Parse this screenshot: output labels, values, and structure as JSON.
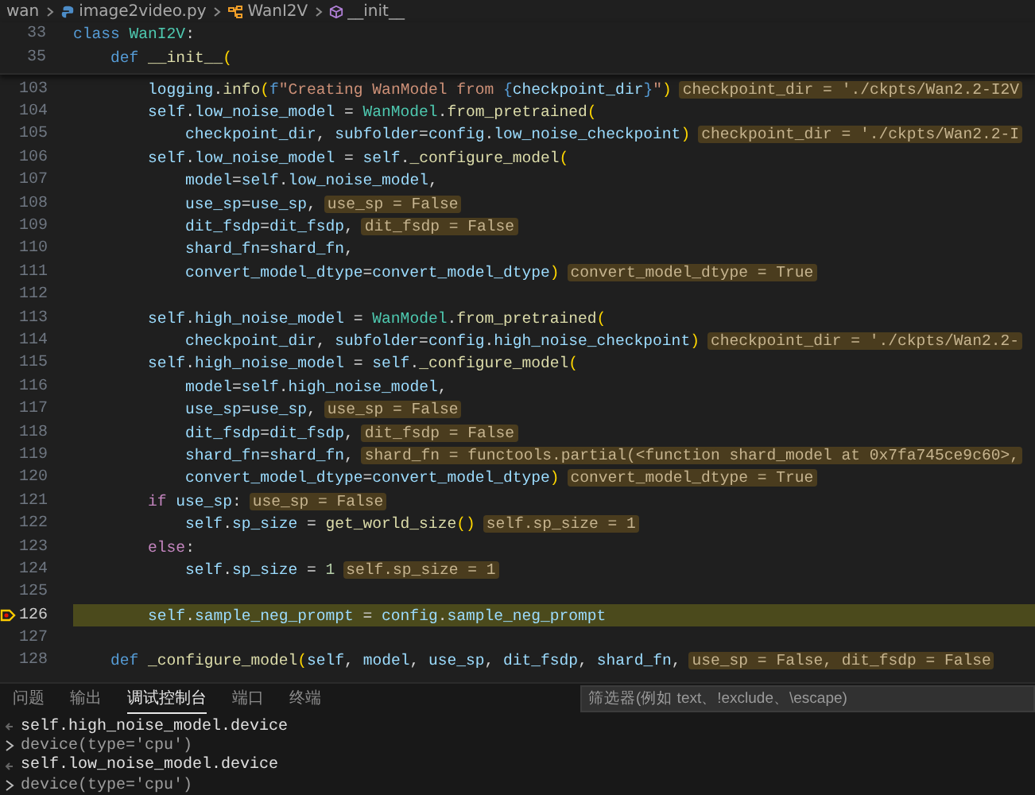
{
  "breadcrumb": [
    {
      "kind": "folder",
      "label": "wan"
    },
    {
      "kind": "file",
      "label": "image2video.py"
    },
    {
      "kind": "class",
      "label": "WanI2V"
    },
    {
      "kind": "method",
      "label": "__init__"
    }
  ],
  "sticky_lines": [
    {
      "number": "33",
      "tokens": [
        {
          "kind": "keyword",
          "text": "class "
        },
        {
          "kind": "type",
          "text": "WanI2V"
        },
        {
          "kind": "plain",
          "text": ":"
        }
      ]
    },
    {
      "number": "35",
      "tokens": [
        {
          "kind": "keyword",
          "text": "    def "
        },
        {
          "kind": "function",
          "text": "__init__"
        },
        {
          "kind": "bracket",
          "text": "("
        }
      ]
    }
  ],
  "lines": [
    {
      "number": "103",
      "current": false,
      "tokens": [
        {
          "kind": "variable",
          "text": "        logging"
        },
        {
          "kind": "plain",
          "text": "."
        },
        {
          "kind": "function",
          "text": "info"
        },
        {
          "kind": "bracket",
          "text": "("
        },
        {
          "kind": "keyword",
          "text": "f"
        },
        {
          "kind": "string",
          "text": "\"Creating WanModel from "
        },
        {
          "kind": "keyword",
          "text": "{"
        },
        {
          "kind": "variable",
          "text": "checkpoint_dir"
        },
        {
          "kind": "keyword",
          "text": "}"
        },
        {
          "kind": "string",
          "text": "\""
        },
        {
          "kind": "bracket",
          "text": ")"
        }
      ],
      "hint": "checkpoint_dir = './ckpts/Wan2.2-I2V"
    },
    {
      "number": "104",
      "current": false,
      "tokens": [
        {
          "kind": "variable",
          "text": "        self"
        },
        {
          "kind": "plain",
          "text": "."
        },
        {
          "kind": "variable",
          "text": "low_noise_model"
        },
        {
          "kind": "plain",
          "text": " = "
        },
        {
          "kind": "type",
          "text": "WanModel"
        },
        {
          "kind": "plain",
          "text": "."
        },
        {
          "kind": "function",
          "text": "from_pretrained"
        },
        {
          "kind": "bracket",
          "text": "("
        }
      ]
    },
    {
      "number": "105",
      "current": false,
      "tokens": [
        {
          "kind": "variable",
          "text": "            checkpoint_dir"
        },
        {
          "kind": "plain",
          "text": ", "
        },
        {
          "kind": "variable",
          "text": "subfolder"
        },
        {
          "kind": "plain",
          "text": "="
        },
        {
          "kind": "variable",
          "text": "config"
        },
        {
          "kind": "plain",
          "text": "."
        },
        {
          "kind": "variable",
          "text": "low_noise_checkpoint"
        },
        {
          "kind": "bracket",
          "text": ")"
        }
      ],
      "hint": "checkpoint_dir = './ckpts/Wan2.2-I"
    },
    {
      "number": "106",
      "current": false,
      "tokens": [
        {
          "kind": "variable",
          "text": "        self"
        },
        {
          "kind": "plain",
          "text": "."
        },
        {
          "kind": "variable",
          "text": "low_noise_model"
        },
        {
          "kind": "plain",
          "text": " = "
        },
        {
          "kind": "variable",
          "text": "self"
        },
        {
          "kind": "plain",
          "text": "."
        },
        {
          "kind": "function",
          "text": "_configure_model"
        },
        {
          "kind": "bracket",
          "text": "("
        }
      ]
    },
    {
      "number": "107",
      "current": false,
      "tokens": [
        {
          "kind": "variable",
          "text": "            model"
        },
        {
          "kind": "plain",
          "text": "="
        },
        {
          "kind": "variable",
          "text": "self"
        },
        {
          "kind": "plain",
          "text": "."
        },
        {
          "kind": "variable",
          "text": "low_noise_model"
        },
        {
          "kind": "plain",
          "text": ","
        }
      ]
    },
    {
      "number": "108",
      "current": false,
      "tokens": [
        {
          "kind": "variable",
          "text": "            use_sp"
        },
        {
          "kind": "plain",
          "text": "="
        },
        {
          "kind": "variable",
          "text": "use_sp"
        },
        {
          "kind": "plain",
          "text": ","
        }
      ],
      "hint": "use_sp = False"
    },
    {
      "number": "109",
      "current": false,
      "tokens": [
        {
          "kind": "variable",
          "text": "            dit_fsdp"
        },
        {
          "kind": "plain",
          "text": "="
        },
        {
          "kind": "variable",
          "text": "dit_fsdp"
        },
        {
          "kind": "plain",
          "text": ","
        }
      ],
      "hint": "dit_fsdp = False"
    },
    {
      "number": "110",
      "current": false,
      "tokens": [
        {
          "kind": "variable",
          "text": "            shard_fn"
        },
        {
          "kind": "plain",
          "text": "="
        },
        {
          "kind": "variable",
          "text": "shard_fn"
        },
        {
          "kind": "plain",
          "text": ","
        }
      ]
    },
    {
      "number": "111",
      "current": false,
      "tokens": [
        {
          "kind": "variable",
          "text": "            convert_model_dtype"
        },
        {
          "kind": "plain",
          "text": "="
        },
        {
          "kind": "variable",
          "text": "convert_model_dtype"
        },
        {
          "kind": "bracket",
          "text": ")"
        }
      ],
      "hint": "convert_model_dtype = True"
    },
    {
      "number": "112",
      "current": false
    },
    {
      "number": "113",
      "current": false,
      "tokens": [
        {
          "kind": "variable",
          "text": "        self"
        },
        {
          "kind": "plain",
          "text": "."
        },
        {
          "kind": "variable",
          "text": "high_noise_model"
        },
        {
          "kind": "plain",
          "text": " = "
        },
        {
          "kind": "type",
          "text": "WanModel"
        },
        {
          "kind": "plain",
          "text": "."
        },
        {
          "kind": "function",
          "text": "from_pretrained"
        },
        {
          "kind": "bracket",
          "text": "("
        }
      ]
    },
    {
      "number": "114",
      "current": false,
      "tokens": [
        {
          "kind": "variable",
          "text": "            checkpoint_dir"
        },
        {
          "kind": "plain",
          "text": ", "
        },
        {
          "kind": "variable",
          "text": "subfolder"
        },
        {
          "kind": "plain",
          "text": "="
        },
        {
          "kind": "variable",
          "text": "config"
        },
        {
          "kind": "plain",
          "text": "."
        },
        {
          "kind": "variable",
          "text": "high_noise_checkpoint"
        },
        {
          "kind": "bracket",
          "text": ")"
        }
      ],
      "hint": "checkpoint_dir = './ckpts/Wan2.2-"
    },
    {
      "number": "115",
      "current": false,
      "tokens": [
        {
          "kind": "variable",
          "text": "        self"
        },
        {
          "kind": "plain",
          "text": "."
        },
        {
          "kind": "variable",
          "text": "high_noise_model"
        },
        {
          "kind": "plain",
          "text": " = "
        },
        {
          "kind": "variable",
          "text": "self"
        },
        {
          "kind": "plain",
          "text": "."
        },
        {
          "kind": "function",
          "text": "_configure_model"
        },
        {
          "kind": "bracket",
          "text": "("
        }
      ]
    },
    {
      "number": "116",
      "current": false,
      "tokens": [
        {
          "kind": "variable",
          "text": "            model"
        },
        {
          "kind": "plain",
          "text": "="
        },
        {
          "kind": "variable",
          "text": "self"
        },
        {
          "kind": "plain",
          "text": "."
        },
        {
          "kind": "variable",
          "text": "high_noise_model"
        },
        {
          "kind": "plain",
          "text": ","
        }
      ]
    },
    {
      "number": "117",
      "current": false,
      "tokens": [
        {
          "kind": "variable",
          "text": "            use_sp"
        },
        {
          "kind": "plain",
          "text": "="
        },
        {
          "kind": "variable",
          "text": "use_sp"
        },
        {
          "kind": "plain",
          "text": ","
        }
      ],
      "hint": "use_sp = False"
    },
    {
      "number": "118",
      "current": false,
      "tokens": [
        {
          "kind": "variable",
          "text": "            dit_fsdp"
        },
        {
          "kind": "plain",
          "text": "="
        },
        {
          "kind": "variable",
          "text": "dit_fsdp"
        },
        {
          "kind": "plain",
          "text": ","
        }
      ],
      "hint": "dit_fsdp = False"
    },
    {
      "number": "119",
      "current": false,
      "tokens": [
        {
          "kind": "variable",
          "text": "            shard_fn"
        },
        {
          "kind": "plain",
          "text": "="
        },
        {
          "kind": "variable",
          "text": "shard_fn"
        },
        {
          "kind": "plain",
          "text": ","
        }
      ],
      "hint": "shard_fn = functools.partial(<function shard_model at 0x7fa745ce9c60>,"
    },
    {
      "number": "120",
      "current": false,
      "tokens": [
        {
          "kind": "variable",
          "text": "            convert_model_dtype"
        },
        {
          "kind": "plain",
          "text": "="
        },
        {
          "kind": "variable",
          "text": "convert_model_dtype"
        },
        {
          "kind": "bracket",
          "text": ")"
        }
      ],
      "hint": "convert_model_dtype = True"
    },
    {
      "number": "121",
      "current": false,
      "tokens": [
        {
          "kind": "control",
          "text": "        if "
        },
        {
          "kind": "variable",
          "text": "use_sp"
        },
        {
          "kind": "plain",
          "text": ":"
        }
      ],
      "hint": "use_sp = False"
    },
    {
      "number": "122",
      "current": false,
      "tokens": [
        {
          "kind": "variable",
          "text": "            self"
        },
        {
          "kind": "plain",
          "text": "."
        },
        {
          "kind": "variable",
          "text": "sp_size"
        },
        {
          "kind": "plain",
          "text": " = "
        },
        {
          "kind": "function",
          "text": "get_world_size"
        },
        {
          "kind": "bracket",
          "text": "()"
        }
      ],
      "hint": "self.sp_size = 1"
    },
    {
      "number": "123",
      "current": false,
      "tokens": [
        {
          "kind": "control",
          "text": "        else"
        },
        {
          "kind": "plain",
          "text": ":"
        }
      ]
    },
    {
      "number": "124",
      "current": false,
      "tokens": [
        {
          "kind": "variable",
          "text": "            self"
        },
        {
          "kind": "plain",
          "text": "."
        },
        {
          "kind": "variable",
          "text": "sp_size"
        },
        {
          "kind": "plain",
          "text": " = "
        },
        {
          "kind": "number",
          "text": "1"
        }
      ],
      "hint": "self.sp_size = 1"
    },
    {
      "number": "125",
      "current": false
    },
    {
      "number": "126",
      "current": true,
      "tokens": [
        {
          "kind": "variable",
          "text": "        self"
        },
        {
          "kind": "plain",
          "text": "."
        },
        {
          "kind": "variable",
          "text": "sample_neg_prompt"
        },
        {
          "kind": "plain",
          "text": " = "
        },
        {
          "kind": "variable",
          "text": "config"
        },
        {
          "kind": "plain",
          "text": "."
        },
        {
          "kind": "variable",
          "text": "sample_neg_prompt"
        }
      ]
    },
    {
      "number": "127",
      "current": false
    },
    {
      "number": "128",
      "current": false,
      "tokens": [
        {
          "kind": "keyword",
          "text": "    def "
        },
        {
          "kind": "function",
          "text": "_configure_model"
        },
        {
          "kind": "bracket",
          "text": "("
        },
        {
          "kind": "variable",
          "text": "self"
        },
        {
          "kind": "plain",
          "text": ", "
        },
        {
          "kind": "variable",
          "text": "model"
        },
        {
          "kind": "plain",
          "text": ", "
        },
        {
          "kind": "variable",
          "text": "use_sp"
        },
        {
          "kind": "plain",
          "text": ", "
        },
        {
          "kind": "variable",
          "text": "dit_fsdp"
        },
        {
          "kind": "plain",
          "text": ", "
        },
        {
          "kind": "variable",
          "text": "shard_fn"
        },
        {
          "kind": "plain",
          "text": ","
        }
      ],
      "hint": "use_sp = False, dit_fsdp = False"
    }
  ],
  "panel": {
    "tabs": [
      {
        "label": "问题",
        "selected": false
      },
      {
        "label": "输出",
        "selected": false
      },
      {
        "label": "调试控制台",
        "selected": true
      },
      {
        "label": "端口",
        "selected": false
      },
      {
        "label": "终端",
        "selected": false
      }
    ],
    "filter": {
      "placeholder": "筛选器(例如 text、!exclude、\\escape)"
    },
    "console": [
      {
        "kind": "input",
        "text": "self.high_noise_model.device"
      },
      {
        "kind": "output",
        "text": "device(type='cpu')"
      },
      {
        "kind": "input",
        "text": "self.low_noise_model.device"
      },
      {
        "kind": "output",
        "text": "device(type='cpu')"
      }
    ]
  }
}
